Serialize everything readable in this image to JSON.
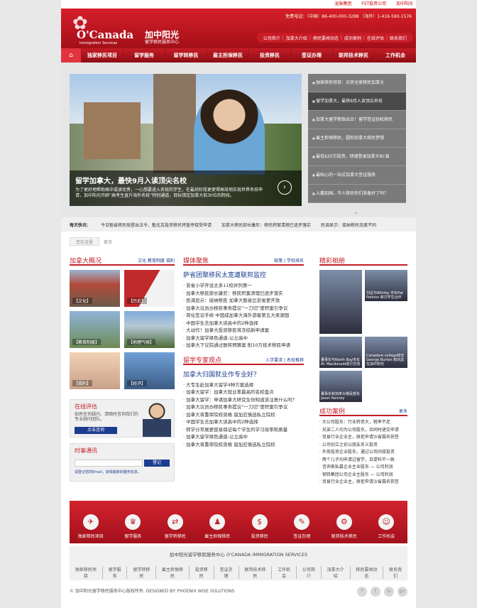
{
  "topbar": {
    "links": [
      "龙脉集团",
      "FST投资公司",
      "加中阳光"
    ]
  },
  "header": {
    "logo_main": "O'Canada",
    "logo_sub": "Immigration Services",
    "logo_cn": "加中阳光",
    "logo_cn_sub": "留学移民服务中心",
    "phone_label": "免费电话：（中国）86-400-000-3288 （海外）1-416-590-1576",
    "topnav": [
      "公司简介",
      "加拿大介绍",
      "移民要闻动态",
      "成功案例",
      "在线评估",
      "联系我们"
    ]
  },
  "mainnav": {
    "home_icon": "home-icon",
    "items": [
      "独家移民项目",
      "留学服务",
      "留学转移民",
      "雇主担保移民",
      "投资移民",
      "签证办理",
      "联邦技术移民",
      "工作机会"
    ]
  },
  "banner": {
    "caption_title": "留学加拿大，最快9月入读顶尖名校",
    "caption_desc": "为了更好地帮助高中或读优秀，一心想要进入名校的学生，在最后阶段更使得高效地实现世界名校申请，加中阳光开辟“高考生直升海外名校”特别通道，目标锁定加拿大前30位的院校。",
    "list": [
      "独家移民项目：买房全家移民加拿大",
      "留学加拿大，最快9月入读顶尖名校",
      "加拿大留学新政出台！留学签证轻松移民",
      "雇主担保移民，圆你加拿大移民梦想",
      "最低$20万投资，快速登录加拿大BC省",
      "最贴心的一站式加拿大签证服务",
      "入籍加国，华人移民你们准备好了吗？"
    ]
  },
  "ticker": {
    "label": "每天快讯：",
    "items": [
      "今日魁省移民局登出法令，魁北克投资移民将暂停接受申请",
      "加拿大移民部长康尼：移民积案清理已逐步落实",
      "民调显示：接纳移民态度不同"
    ]
  },
  "crumb": [
    "您在这里",
    "首页"
  ],
  "col1": {
    "title": "加拿大概况",
    "tabs": [
      "文化",
      "教育制度",
      "福利"
    ],
    "tiles": [
      "【文化】",
      "【历史】",
      "【教育制度】",
      "【地理气候】",
      "【福利】",
      "【经济】"
    ],
    "eval_title": "在线评估",
    "eval_text": "如有任何疑问，请随时咨询我们的专业顾问团队。",
    "eval_btn": "点击咨询",
    "news_title": "时事通讯",
    "news_btn": "登记",
    "news_note": "请登记您的Email，获得最新的服务信息。"
  },
  "col2": {
    "title": "媒体聚焦",
    "tabs": [
      "政策",
      "学校排名"
    ],
    "headline": "萨省团聚移民太宽遭联邦监控",
    "items": [
      "安省小学开设太多11校并列第一",
      "加拿大移民部长康尼：移民积案清理已逐步落实",
      "民调显示：接纳移民 加拿大魁省比安省更开放",
      "加拿大议员办移民事务提议“一刀切”度积案引争议",
      "简化签证手续 中国成加拿大海外游客第五大来源国",
      "中国学生去加拿大读高中的2种选择",
      "大动作！加拿大投资移民将冻结新申请案",
      "加拿大留学择色通道-公立高中",
      "加拿大下议院通过联邦预算案 削10万技术移民申请"
    ],
    "sub_title": "留学专家观点",
    "sub_tabs": [
      "入学要求",
      "名校推荐"
    ],
    "sub_headline": "加拿大归国就业作专业好？",
    "sub_items": [
      "大专生赴加拿大留学4种方案选择",
      "加拿大留学：加拿大就业率最高的名校盘点",
      "加拿大留学：申请加拿大研究生你知道该注意什么吗？",
      "加拿大议员办移民事务提议“一刀切”度积案引争议",
      "加拿大将重审院校资格 留加应慎选私立院校",
      "中国学生去加拿大读高中的2种选择",
      "转学分常展更容易保证每个学生的学习效率和质量",
      "加拿大留学择色通道-公立高中",
      "加拿大将重审院校资格 留加应慎选私立院校"
    ]
  },
  "col3": {
    "title": "精彩相册",
    "gallery": [
      "刘总与Whitby 市长Pat Perkins 商讨学生合作",
      "董事长与North Bay市长 Al. Macdonald进行交流",
      "Canadore college校长 George Burton 和刘总在加中阳光",
      "董事长和加拿大移民部长Jason Kenney"
    ],
    "case_title": "成功案例",
    "case_more": "更多",
    "cases": [
      "大公司股东：行业转资大，税率不足",
      "兄弟二人均为公司股东，且同时递交申请",
      "贸易行业企业主，原拒申请沙省摄名获签",
      "公司创立之初以朋友名义投资",
      "外商投资企业股东，通过公司间接投资",
      "两个儿子均申请过留学，且提料不一致",
      "咨询美私募企业主业股东 — 公司利润",
      "钢铁集团公司企业主股东 — 公司利润",
      "贸易行业企业主，原拒申请沙省摄名获签"
    ]
  },
  "services": [
    {
      "icon": "passport-icon",
      "label": "独家移民项目"
    },
    {
      "icon": "graduation-icon",
      "label": "留学服务"
    },
    {
      "icon": "transfer-icon",
      "label": "留学转移民"
    },
    {
      "icon": "employer-icon",
      "label": "雇主担保移民"
    },
    {
      "icon": "investment-icon",
      "label": "投资移民"
    },
    {
      "icon": "visa-icon",
      "label": "签证办理"
    },
    {
      "icon": "gear-icon",
      "label": "联邦技术移民"
    },
    {
      "icon": "job-icon",
      "label": "工作机会"
    }
  ],
  "footer": {
    "name": "加中阳光留学移民服务中心  O'CANADA IMMIGRATION SERVICES",
    "links": [
      "独家移民项目",
      "留学服务",
      "留学转移民",
      "雇主担保移民",
      "投资移民",
      "签证办理",
      "联邦技术移民",
      "工作机会",
      "公司简介",
      "加拿大介绍",
      "移民要闻动态",
      "联系我们"
    ],
    "copyright": "© 加中阳光留学移民服务中心版权所有.     DESIGNED BY: PHOENIX WISE SOLUTIONS",
    "social": [
      "f",
      "t",
      "in",
      "g+"
    ]
  }
}
